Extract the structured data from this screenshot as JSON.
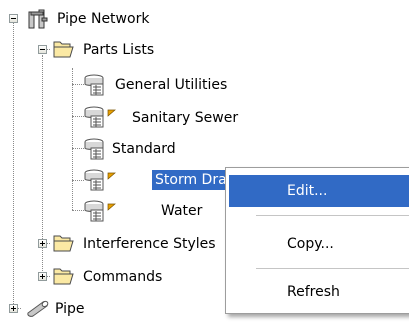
{
  "tree": {
    "pipe_network": "Pipe Network",
    "parts_lists": "Parts Lists",
    "general_utilities": "General Utilities",
    "sanitary_sewer": "Sanitary Sewer",
    "standard": "Standard",
    "storm_drain": "Storm Drain",
    "water": "Water",
    "interference_styles": "Interference Styles",
    "commands": "Commands",
    "pipe": "Pipe"
  },
  "context_menu": {
    "items": [
      {
        "label": "Edit...",
        "highlighted": true
      },
      {
        "label": "Copy..."
      },
      {
        "label": "Refresh"
      }
    ]
  },
  "colors": {
    "selection": "#316ac5",
    "folder": "#fbe9a4",
    "flag": "#e8a000"
  }
}
